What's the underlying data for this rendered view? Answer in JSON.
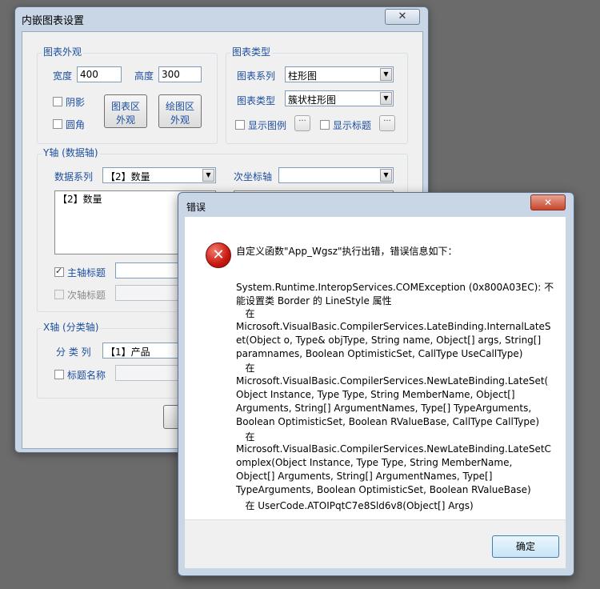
{
  "main_window": {
    "title": "内嵌图表设置",
    "close_glyph": "✕",
    "appearance": {
      "legend": "图表外观",
      "width_label": "宽度",
      "width_value": "400",
      "height_label": "高度",
      "height_value": "300",
      "shadow_label": "阴影",
      "rounded_label": "圆角",
      "chart_area_button": [
        "图表区",
        "外观"
      ],
      "plot_area_button": [
        "绘图区",
        "外观"
      ]
    },
    "chart_type": {
      "legend": "图表类型",
      "series_label": "图表系列",
      "series_value": "柱形图",
      "type_label": "图表类型",
      "type_value": "簇状柱形图",
      "show_legend_label": "显示图例",
      "show_title_label": "显示标题",
      "dots": "···"
    },
    "y_axis": {
      "legend": "Y轴 (数据轴)",
      "data_series_label": "数据系列",
      "data_series_value": "【2】数量",
      "secondary_axis_label": "次坐标轴",
      "list_items": [
        "【2】数量"
      ],
      "primary_title_label": "主轴标题",
      "secondary_title_label": "次轴标题"
    },
    "x_axis": {
      "legend": "X轴 (分类轴)",
      "category_label": "分 类 列",
      "category_value": "【1】产品",
      "title_name_label": "标题名称"
    }
  },
  "error_dialog": {
    "title": "错误",
    "close_glyph": "✕",
    "icon": "error-x-icon",
    "icon_glyph": "✕",
    "message_lines": [
      "自定义函数\"App_Wgsz\"执行出错，错误信息如下：",
      "",
      "System.Runtime.InteropServices.COMException (0x800A03EC): 不",
      "能设置类 Border 的 LineStyle 属性",
      "   在",
      "Microsoft.VisualBasic.CompilerServices.LateBinding.InternalLateS",
      "et(Object o, Type& objType, String name, Object[] args, String[]",
      "paramnames, Boolean OptimisticSet, CallType UseCallType)",
      "   在",
      "Microsoft.VisualBasic.CompilerServices.NewLateBinding.LateSet(",
      "Object Instance, Type Type, String MemberName, Object[]",
      "Arguments, String[] ArgumentNames, Type[] TypeArguments,",
      "Boolean OptimisticSet, Boolean RValueBase, CallType CallType)",
      "   在",
      "Microsoft.VisualBasic.CompilerServices.NewLateBinding.LateSetC",
      "omplex(Object Instance, Type Type, String MemberName,",
      "Object[] Arguments, String[] ArgumentNames, Type[]",
      "TypeArguments, Boolean OptimisticSet, Boolean RValueBase)",
      "   在 UserCode.ATOIPqtC7e8Sld6v8(Object[] Args)"
    ],
    "ok_label": "确定"
  }
}
